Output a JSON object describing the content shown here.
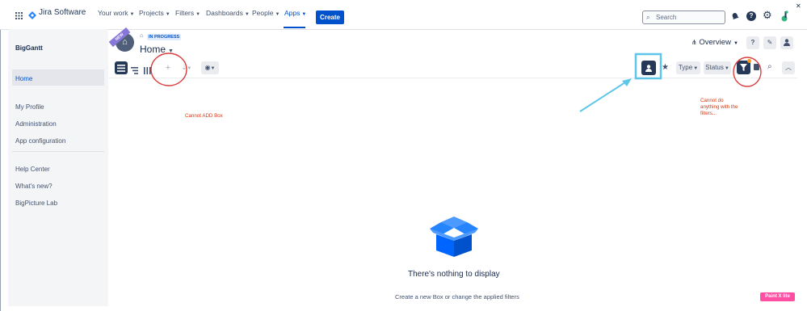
{
  "nav": {
    "product": "Jira Software",
    "items": [
      {
        "label": "Your work"
      },
      {
        "label": "Projects"
      },
      {
        "label": "Filters"
      },
      {
        "label": "Dashboards"
      },
      {
        "label": "People"
      },
      {
        "label": "Apps"
      }
    ],
    "create": "Create",
    "search_placeholder": "Search"
  },
  "sidebar": {
    "title": "BigGantt",
    "items": [
      "Home",
      "My Profile",
      "Administration",
      "App configuration",
      "Help Center",
      "What's new?",
      "BigPicture Lab"
    ]
  },
  "header": {
    "ribbon": "NEW",
    "status": "IN PROGRESS",
    "title": "Home",
    "overview": "Overview"
  },
  "toolbar": {
    "type_label": "Type",
    "status_label": "Status"
  },
  "annotations": {
    "left_note": "Cannot ADD Box",
    "right_note_lines": [
      "Cannot do",
      "anything with the",
      "filters..."
    ],
    "highlight_color": "#d93f3f",
    "arrow_color": "#5fc6ea"
  },
  "empty_state": {
    "title": "There's nothing to display",
    "subtitle": "Create a new Box or change the applied filters"
  },
  "watermark": "Paint X lite"
}
